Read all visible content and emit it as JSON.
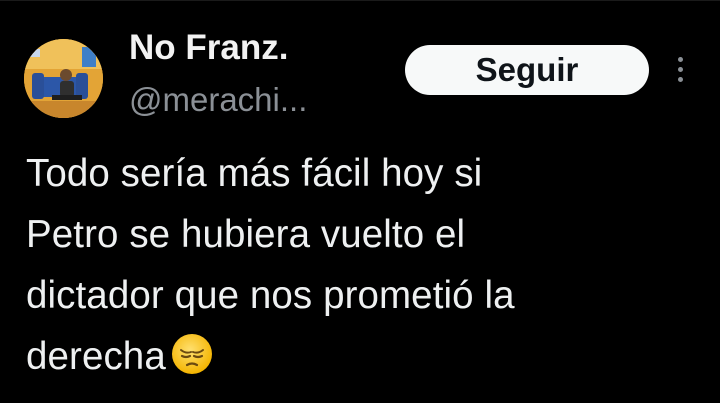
{
  "author": {
    "display_name": "No Franz.",
    "handle": "@merachi..."
  },
  "follow_button": {
    "label": "Seguir"
  },
  "more_menu": {
    "icon": "more-vertical-icon"
  },
  "tweet": {
    "lines": [
      "Todo sería más fácil hoy si",
      "Petro se hubiera vuelto el",
      "dictador que nos prometió la",
      "derecha"
    ],
    "emoji": "pensive-face-emoji"
  },
  "colors": {
    "background": "#000000",
    "text": "#e7e9ea",
    "secondary_text": "#8b9096",
    "button_bg": "#f7f9f9",
    "button_text": "#0f1419"
  }
}
